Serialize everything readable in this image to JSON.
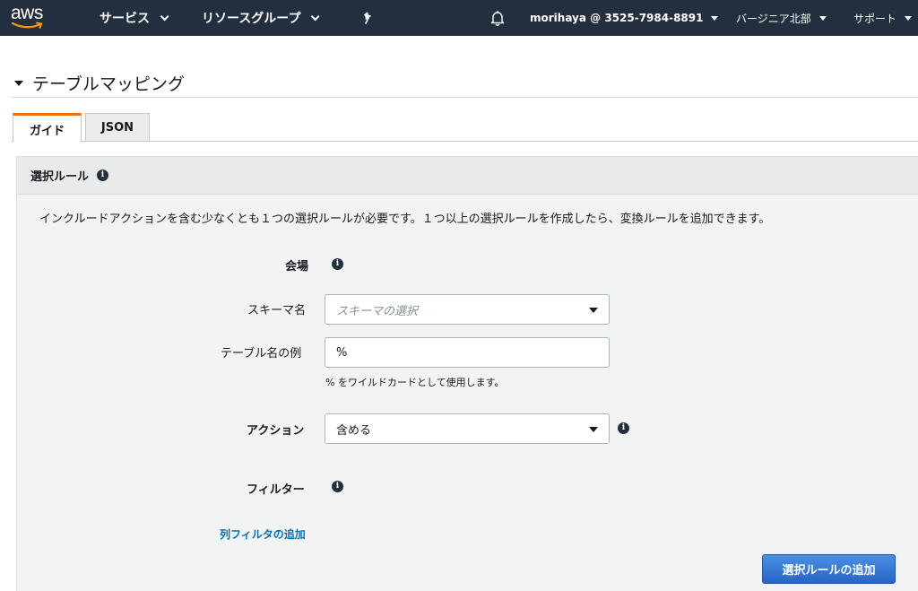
{
  "topnav": {
    "logo_text": "aws",
    "services": "サービス",
    "resource_groups": "リソースグループ",
    "account": "morihaya @ 3525-7984-8891",
    "region": "バージニア北部",
    "support": "サポート",
    "bg_color": "#232f3e"
  },
  "section": {
    "title": "テーブルマッピング"
  },
  "tabs": [
    {
      "label": "ガイド",
      "active": true
    },
    {
      "label": "JSON",
      "active": false
    }
  ],
  "panel": {
    "title": "選択ルール",
    "intro": "インクルードアクションを含む少なくとも１つの選択ルールが必要です。１つ以上の選択ルールを作成したら、変換ルールを追加できます。",
    "venue_label": "会場",
    "schema": {
      "label": "スキーマ名",
      "placeholder": "スキーマの選択"
    },
    "table": {
      "label": "テーブル名の例",
      "value": "%",
      "hint": "% をワイルドカードとして使用します。"
    },
    "action": {
      "label": "アクション",
      "value": "含める"
    },
    "filter_label": "フィルター",
    "add_filter_link": "列フィルタの追加",
    "add_rule_button": "選択ルールの追加"
  },
  "colors": {
    "accent_tab": "#ec7211",
    "link": "#0073bb",
    "primary_button": "#2b6fd0"
  }
}
